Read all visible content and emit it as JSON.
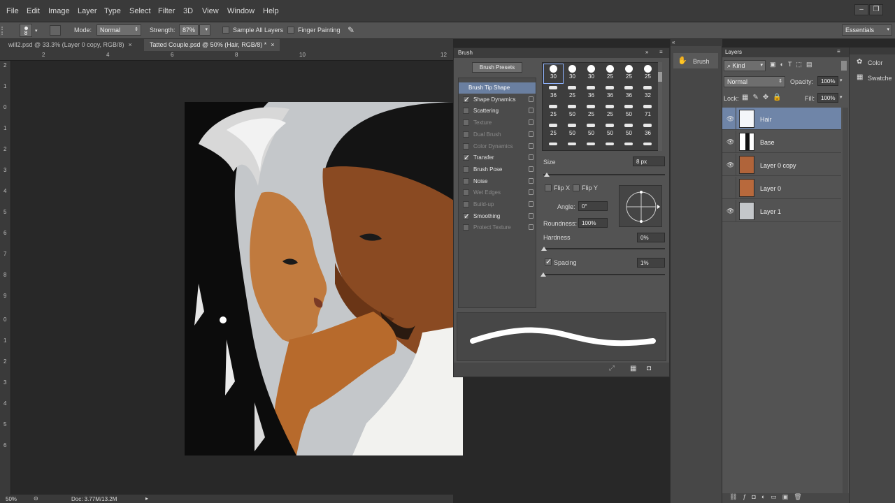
{
  "menu": [
    "File",
    "Edit",
    "Image",
    "Layer",
    "Type",
    "Select",
    "Filter",
    "3D",
    "View",
    "Window",
    "Help"
  ],
  "options_bar": {
    "brush_size": "8",
    "mode_label": "Mode:",
    "mode_value": "Normal",
    "strength_label": "Strength:",
    "strength_value": "87%",
    "sample_all_layers": "Sample All Layers",
    "finger_painting": "Finger Painting",
    "workspace": "Essentials"
  },
  "doc_tabs": [
    {
      "label": "will2.psd @ 33.3% (Layer 0 copy, RGB/8)",
      "active": false
    },
    {
      "label": "Tatted Couple.psd @ 50% (Hair, RGB/8) *",
      "active": true
    }
  ],
  "ruler_top": [
    "2",
    "4",
    "6",
    "8",
    "10",
    "12"
  ],
  "ruler_left": [
    "2",
    "1",
    "0",
    "1",
    "2",
    "3",
    "4",
    "5",
    "6",
    "7",
    "8",
    "9",
    "0",
    "1",
    "2",
    "3",
    "4",
    "5",
    "6"
  ],
  "status": {
    "zoom": "50%",
    "doc": "Doc: 3.77M/13.2M"
  },
  "brush_panel": {
    "tab": "Brush",
    "presets_button": "Brush Presets",
    "options": [
      {
        "label": "Brush Tip Shape",
        "selected": true,
        "checked": false,
        "dim": false,
        "nochk": true
      },
      {
        "label": "Shape Dynamics",
        "selected": false,
        "checked": true,
        "dim": false
      },
      {
        "label": "Scattering",
        "selected": false,
        "checked": false,
        "dim": false
      },
      {
        "label": "Texture",
        "selected": false,
        "checked": false,
        "dim": true
      },
      {
        "label": "Dual Brush",
        "selected": false,
        "checked": false,
        "dim": true
      },
      {
        "label": "Color Dynamics",
        "selected": false,
        "checked": false,
        "dim": true
      },
      {
        "label": "Transfer",
        "selected": false,
        "checked": true,
        "dim": false
      },
      {
        "label": "Brush Pose",
        "selected": false,
        "checked": false,
        "dim": false
      },
      {
        "label": "Noise",
        "selected": false,
        "checked": false,
        "dim": false
      },
      {
        "label": "Wet Edges",
        "selected": false,
        "checked": false,
        "dim": true
      },
      {
        "label": "Build-up",
        "selected": false,
        "checked": false,
        "dim": true
      },
      {
        "label": "Smoothing",
        "selected": false,
        "checked": true,
        "dim": false
      },
      {
        "label": "Protect Texture",
        "selected": false,
        "checked": false,
        "dim": true
      }
    ],
    "tip_sizes": [
      [
        "30",
        "30",
        "30",
        "25",
        "25",
        "25"
      ],
      [
        "36",
        "25",
        "36",
        "36",
        "36",
        "32"
      ],
      [
        "25",
        "50",
        "25",
        "25",
        "50",
        "71"
      ],
      [
        "25",
        "50",
        "50",
        "50",
        "50",
        "36"
      ]
    ],
    "size_label": "Size",
    "size_value": "8 px",
    "flip_x": "Flip X",
    "flip_y": "Flip Y",
    "angle_label": "Angle:",
    "angle_value": "0°",
    "roundness_label": "Roundness:",
    "roundness_value": "100%",
    "hardness_label": "Hardness",
    "hardness_value": "0%",
    "spacing_label": "Spacing",
    "spacing_value": "1%"
  },
  "dock": {
    "brush": "Brush"
  },
  "layers_panel": {
    "tab": "Layers",
    "kind": "Kind",
    "blend": "Normal",
    "opacity_label": "Opacity:",
    "opacity_value": "100%",
    "lock_label": "Lock:",
    "fill_label": "Fill:",
    "fill_value": "100%",
    "layers": [
      {
        "name": "Hair",
        "selected": true,
        "visible": true
      },
      {
        "name": "Base",
        "selected": false,
        "visible": true
      },
      {
        "name": "Layer 0 copy",
        "selected": false,
        "visible": true
      },
      {
        "name": "Layer 0",
        "selected": false,
        "visible": false
      },
      {
        "name": "Layer 1",
        "selected": false,
        "visible": true
      }
    ]
  },
  "right_panel": {
    "color": "Color",
    "swatches": "Swatche"
  }
}
